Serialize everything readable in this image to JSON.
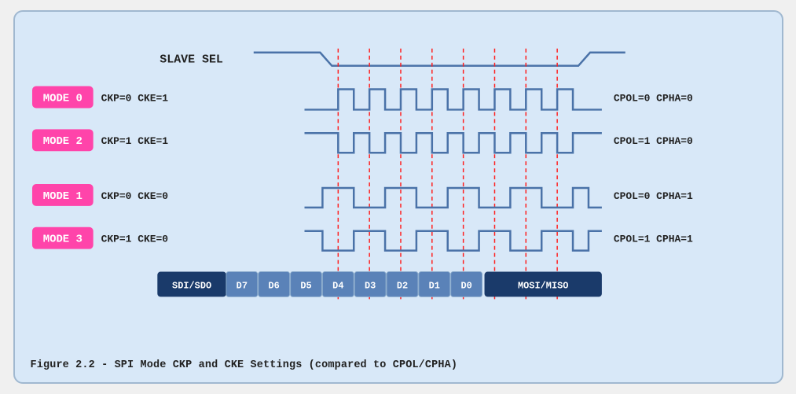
{
  "diagram": {
    "title": "Figure 2.2 - SPI Mode CKP and CKE Settings (compared to CPOL/CPHA)",
    "slave_sel_label": "SLAVE SEL",
    "modes": [
      {
        "label": "MODE 0",
        "params": "CKP=0  CKE=1",
        "right": "CPOL=0  CPHA=0"
      },
      {
        "label": "MODE 2",
        "params": "CKP=1  CKE=1",
        "right": "CPOL=1  CPHA=0"
      },
      {
        "label": "MODE 1",
        "params": "CKP=0  CKE=0",
        "right": "CPOL=0  CPHA=1"
      },
      {
        "label": "MODE 3",
        "params": "CKP=1  CKE=0",
        "right": "CPOL=1  CPHA=1"
      }
    ],
    "data_labels": [
      "SDI/SDO",
      "D7",
      "D6",
      "D5",
      "D4",
      "D3",
      "D2",
      "D1",
      "D0",
      "MOSI/MISO"
    ],
    "colors": {
      "mode_bg": "#ff44aa",
      "mode_text": "white",
      "wave_stroke": "#4a72a8",
      "wave_fill": "#6a9acc",
      "red_dashes": "#ff2020",
      "data_bar_dark": "#1a3a6a",
      "data_bar_light": "#5a82b8",
      "data_text": "white"
    }
  }
}
